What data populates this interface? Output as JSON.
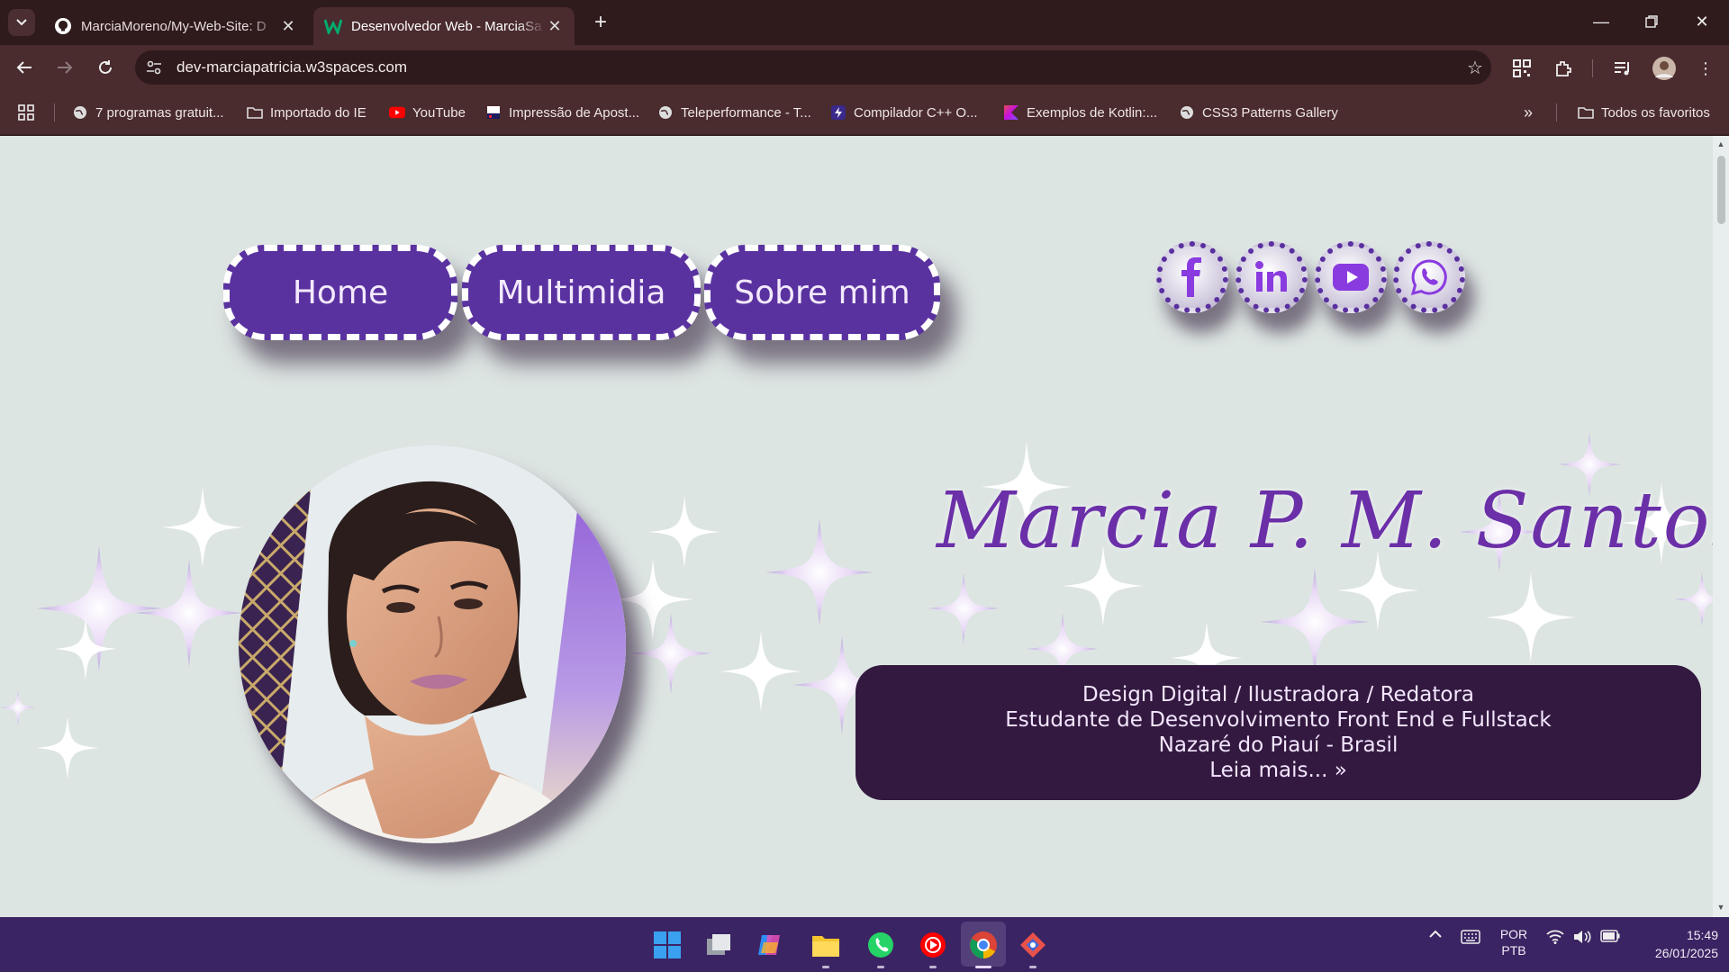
{
  "browser": {
    "tabs": [
      {
        "title": "MarciaMoreno/My-Web-Site: D",
        "active": false
      },
      {
        "title": "Desenvolvedor Web - MarciaSa",
        "active": true
      }
    ],
    "url": "dev-marciapatricia.w3spaces.com",
    "bookmarks": [
      {
        "label": "7 programas gratuit...",
        "icon": "globe-icon"
      },
      {
        "label": "Importado do IE",
        "icon": "folder-icon"
      },
      {
        "label": "YouTube",
        "icon": "youtube-icon"
      },
      {
        "label": "Impressão de Apost...",
        "icon": "print-icon"
      },
      {
        "label": "Teleperformance - T...",
        "icon": "globe-icon"
      },
      {
        "label": "Compilador C++ O...",
        "icon": "bolt-icon"
      },
      {
        "label": "Exemplos de Kotlin:...",
        "icon": "kotlin-icon"
      },
      {
        "label": "CSS3 Patterns Gallery",
        "icon": "globe-icon"
      }
    ],
    "all_bookmarks": "Todos os favoritos"
  },
  "site": {
    "nav": [
      "Home",
      "Multimidia",
      "Sobre mim"
    ],
    "social": [
      "facebook-icon",
      "linkedin-icon",
      "youtube-icon",
      "whatsapp-icon"
    ],
    "name": "Marcia P. M. Santos",
    "info": {
      "line1": "Design Digital / Ilustradora / Redatora",
      "line2": "Estudante de Desenvolvimento Front End e Fullstack",
      "line3": "Nazaré do Piauí - Brasil",
      "more": "Leia mais... »"
    },
    "colors": {
      "accent": "#5a32a0",
      "name": "#6b2fa8",
      "box": "#33193f",
      "page": "#dde5e3"
    }
  },
  "taskbar": {
    "lang_top": "POR",
    "lang_bottom": "PTB",
    "time": "15:49",
    "date": "26/01/2025"
  }
}
